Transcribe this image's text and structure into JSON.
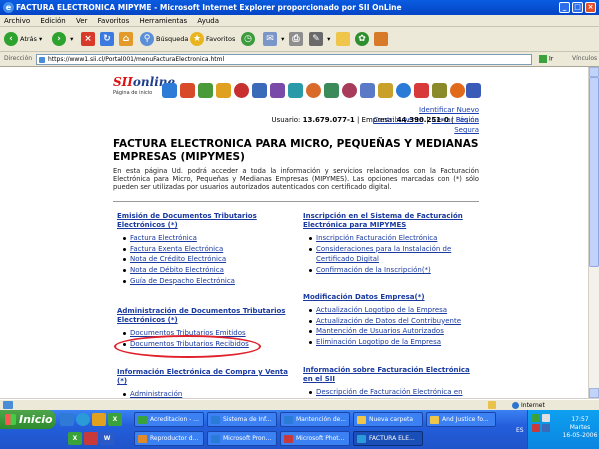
{
  "window": {
    "title": "FACTURA ELECTRONICA MIPYME - Microsoft Internet Explorer proporcionado por SII OnLine"
  },
  "menu": [
    "Archivo",
    "Edición",
    "Ver",
    "Favoritos",
    "Herramientas",
    "Ayuda"
  ],
  "toolbar": {
    "back": "Atrás",
    "search": "Búsqueda",
    "favorites": "Favoritos"
  },
  "address": {
    "label": "Dirección",
    "url": "https://www1.sii.cl/Portal001/menuFacturaElectronica.html",
    "go": "Ir",
    "links": "Vínculos"
  },
  "logo": {
    "brand_a": "SII",
    "brand_b": "online",
    "caption": "Página de inicio"
  },
  "page": {
    "links": {
      "new_taxpayer": "Identificar Nuevo Contribuyente",
      "logout": "Cerrar Sesión",
      "secure": "Página Segura"
    },
    "user": {
      "user_label": "Usuario:",
      "user_id": "13.679.077-1",
      "company_label": "Empresa:",
      "company_id": "44.390.251-0"
    },
    "title": "FACTURA ELECTRONICA PARA MICRO, PEQUEÑAS Y MEDIANAS EMPRESAS (MIPYMES)",
    "intro": "En esta página Ud. podrá acceder a toda la información y servicios relacionados con la Facturación Electrónica para Micro, Pequeñas y Medianas Empresas (MIPYMES). Las opciones marcadas con (*) sólo pueden ser utilizadas por usuarios autorizados autenticados con certificado digital.",
    "sections": [
      {
        "title": "Emisión de Documentos Tributarios Electrónicos (*)",
        "items": [
          "Factura Electrónica",
          "Factura Exenta Electrónica",
          "Nota de Crédito Electrónica",
          "Nota de Débito Electrónica",
          "Guía de Despacho Electrónica"
        ]
      },
      {
        "title": "Administración de Documentos Tributarios Electrónicos (*)",
        "items": [
          "Documentos Tributarios Emitidos",
          "Documentos Tributarios Recibidos"
        ]
      },
      {
        "title": "Información Electrónica de Compra y Venta (*)",
        "items": [
          "Administración"
        ]
      },
      {
        "title": "Inscripción en el Sistema de Facturación Electrónica para MIPYMES",
        "items": [
          "Inscripción Facturación Electrónica",
          "Consideraciones para la Instalación de Certificado Digital",
          "Confirmación de la Inscripción(*)"
        ]
      },
      {
        "title": "Modificación Datos Empresa(*)",
        "items": [
          "Actualización Logotipo de la Empresa",
          "Actualización de Datos del Contribuyente",
          "Mantención de Usuarios Autorizados",
          "Eliminación Logotipo de la Empresa"
        ]
      },
      {
        "title": "Información sobre Facturación Electrónica en el SII",
        "items": [
          "Descripción de Facturación Electrónica en"
        ]
      }
    ]
  },
  "status": {
    "zone": "Internet"
  },
  "taskbar": {
    "start": "Inicio",
    "row1": [
      "Acreditacion - ...",
      "Sistema de Inf...",
      "Mantención de...",
      "Nueva carpeta",
      "And Justice fo..."
    ],
    "row2": [
      "Reproductor d...",
      "Microsoft Pron...",
      "Microsoft Phot...",
      "FACTURA ELE..."
    ],
    "lang": "ES",
    "time": "17:57",
    "day": "Martes",
    "date": "16-05-2006"
  }
}
